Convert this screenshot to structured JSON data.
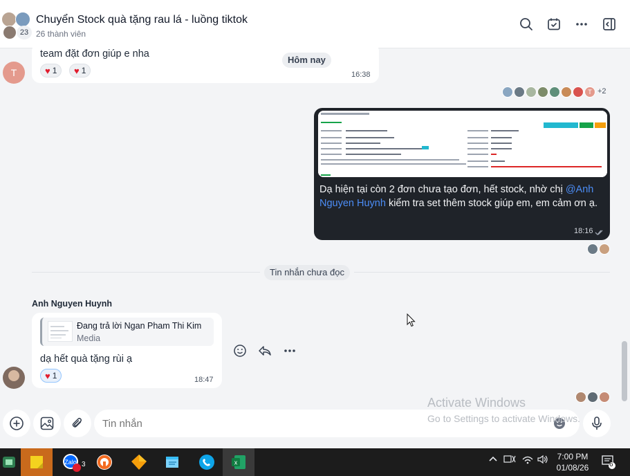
{
  "header": {
    "title": "Chuyển Stock quà tặng rau lá - luồng tiktok",
    "member_count": "26 thành viên",
    "avatar_count": "23"
  },
  "messages": {
    "m1": {
      "text": "team đặt đơn giúp e nha",
      "time": "16:38",
      "reaction1_count": "1",
      "reaction2_count": "1"
    },
    "date_chip": "Hôm nay",
    "seen_more": "+2",
    "m2": {
      "text_before": "Dạ hiện tại còn 2 đơn chưa tạo đơn, hết stock, nhờ chị ",
      "mention": "@Anh Nguyen Huynh",
      "text_after": " kiểm tra set thêm stock giúp em, em cảm ơn ạ.",
      "time": "18:16"
    },
    "unread_divider": "Tin nhắn chưa đọc",
    "m3": {
      "sender": "Anh Nguyen Huynh",
      "reply_title": "Đang trả lời Ngan Pham Thi Kim",
      "reply_sub": "Media",
      "text": "dạ hết quà tặng rùi ạ",
      "reaction_count": "1",
      "time": "18:47"
    }
  },
  "composer": {
    "placeholder": "Tin nhắn"
  },
  "watermark": {
    "line1": "Activate Windows",
    "line2": "Go to Settings to activate Windows."
  },
  "taskbar": {
    "time": "7:00 PM",
    "date": "01/08/26",
    "notification_badge": "3",
    "action_center_count": "6"
  },
  "icons": {
    "reaction": "heart-icon",
    "colors": {
      "accent": "#4c8df6",
      "heart": "#e11d2e",
      "dark_bubble": "#1f2329"
    }
  }
}
